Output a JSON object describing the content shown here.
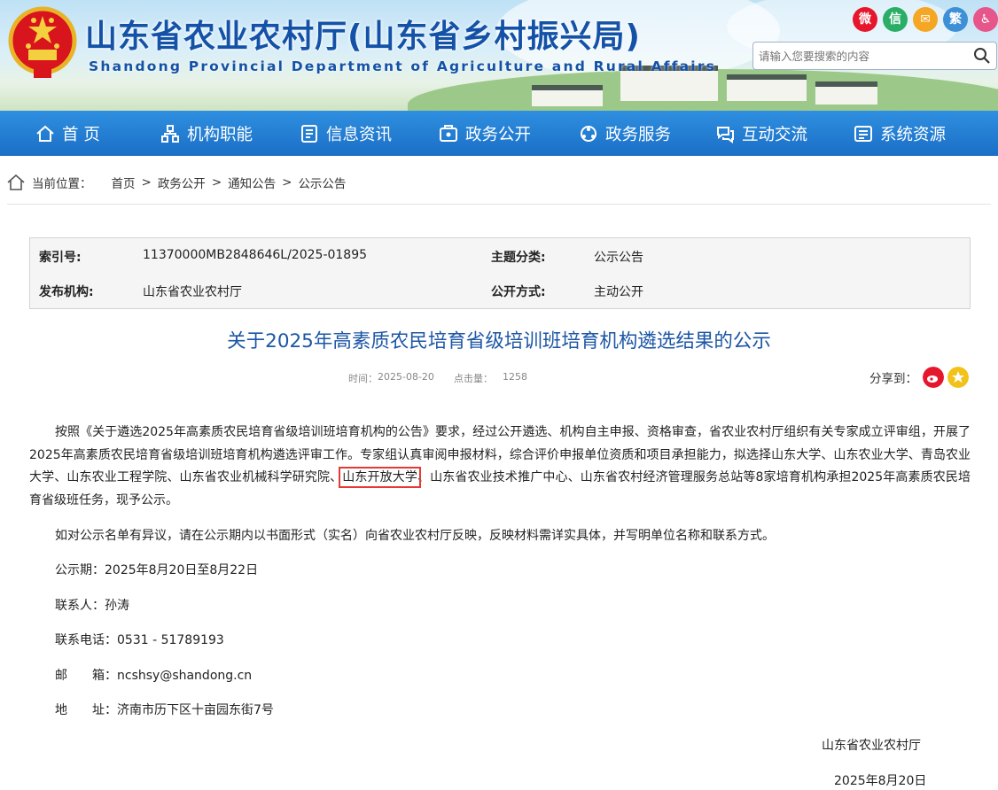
{
  "header": {
    "title_cn": "山东省农业农村厅(山东省乡村振兴局)",
    "title_en": "Shandong Provincial Department of Agriculture and Rural Affairs",
    "search_placeholder": "请输入您要搜索的内容",
    "share_icons": [
      {
        "name": "weibo-icon",
        "glyph": "微",
        "color": "#e6162d"
      },
      {
        "name": "wechat-icon",
        "glyph": "信",
        "color": "#2aae67"
      },
      {
        "name": "mail-icon",
        "glyph": "✉",
        "color": "#f5a623"
      },
      {
        "name": "traditional-chinese-icon",
        "glyph": "繁",
        "color": "#3d8fd6"
      },
      {
        "name": "accessibility-icon",
        "glyph": "♿",
        "color": "#e6568a"
      }
    ]
  },
  "nav": [
    {
      "label": "首 页",
      "icon": "home-icon"
    },
    {
      "label": "机构职能",
      "icon": "org-icon"
    },
    {
      "label": "信息资讯",
      "icon": "news-icon"
    },
    {
      "label": "政务公开",
      "icon": "open-government-icon"
    },
    {
      "label": "政务服务",
      "icon": "service-icon"
    },
    {
      "label": "互动交流",
      "icon": "interaction-icon"
    },
    {
      "label": "系统资源",
      "icon": "system-icon"
    }
  ],
  "breadcrumb": {
    "prefix": "当前位置：",
    "items": [
      "首页",
      "政务公开",
      "通知公告",
      "公示公告"
    ],
    "separator": ">"
  },
  "info": {
    "index_label": "索引号:",
    "index_value": "11370000MB2848646L/2025-01895",
    "topic_label": "主题分类:",
    "topic_value": "公示公告",
    "publisher_label": "发布机构:",
    "publisher_value": "山东省农业农村厅",
    "method_label": "公开方式:",
    "method_value": "主动公开"
  },
  "article": {
    "title": "关于2025年高素质农民培育省级培训班培育机构遴选结果的公示",
    "time_label": "时间：",
    "time_value": "2025-08-20",
    "clicks_label": "点击量：",
    "clicks_value": "1258",
    "share_label": "分享到：",
    "p1_before": "按照《关于遴选2025年高素质农民培育省级培训班培育机构的公告》要求，经过公开遴选、机构自主申报、资格审查，省农业农村厅组织有关专家成立评审组，开展了2025年高素质农民培育省级培训班培育机构遴选评审工作。专家组认真审阅申报材料，综合评价申报单位资质和项目承担能力，拟选择山东大学、山东农业大学、青岛农业大学、山东农业工程学院、山东省农业机械科学研究院、",
    "p1_highlight": "山东开放大学",
    "p1_after": "、山东省农业技术推广中心、山东省农村经济管理服务总站等8家培育机构承担2025年高素质农民培育省级班任务，现予公示。",
    "p2": "如对公示名单有异议，请在公示期内以书面形式（实名）向省农业农村厅反映，反映材料需详实具体，并写明单位名称和联系方式。",
    "period": "公示期：2025年8月20日至8月22日",
    "contact": "联系人：孙涛",
    "phone": "联系电话：0531 - 51789193",
    "email": "邮　　箱：ncshsy@shandong.cn",
    "address": "地　　址：济南市历下区十亩园东街7号",
    "sign_org": "山东省农业农村厅",
    "sign_date": "2025年8月20日"
  }
}
